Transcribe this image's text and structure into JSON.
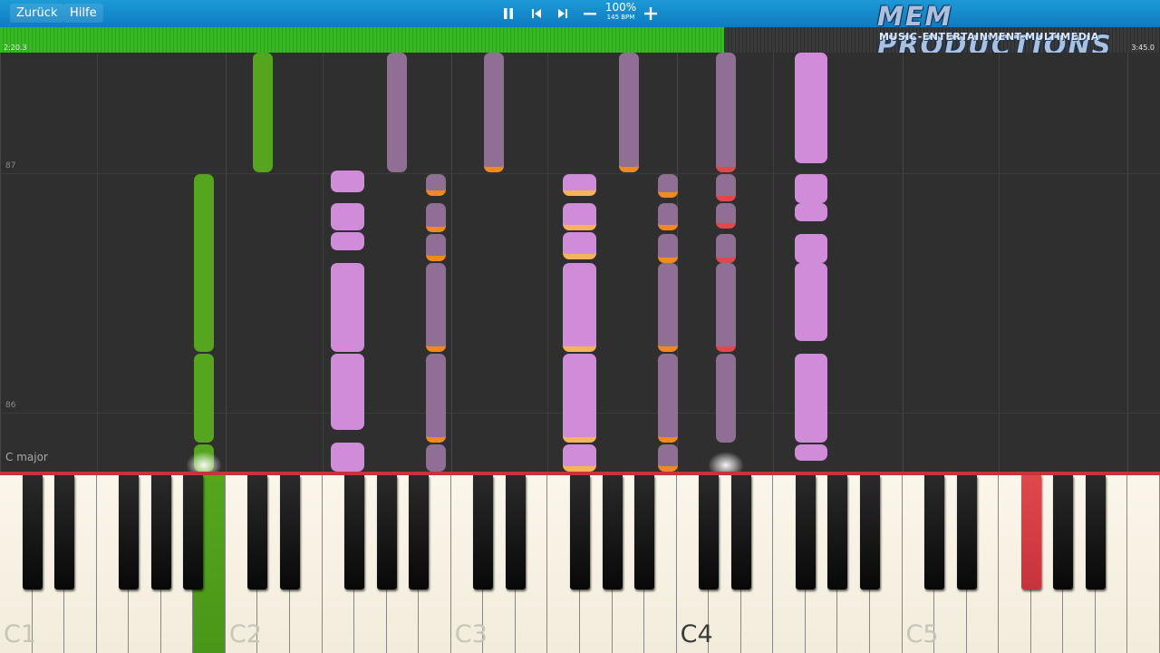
{
  "toolbar": {
    "back_label": "Zurück",
    "help_label": "Hilfe",
    "pause_icon": "pause-icon",
    "prev_icon": "skip-back-icon",
    "next_icon": "skip-forward-icon",
    "minus_icon": "minus-icon",
    "plus_icon": "plus-icon",
    "speed": "100%",
    "bpm": "145 BPM"
  },
  "logo": {
    "line1": "MEM PRODUCTIONS",
    "line2": "MUSIC-ENTERTAINMENT-MULTIMEDIA"
  },
  "progress": {
    "fraction": 0.624,
    "elapsed": "2:20.3",
    "total": "3:45.0"
  },
  "piano_roll": {
    "measure_labels": [
      "87",
      "86"
    ],
    "key_signature": "C major"
  },
  "keyboard": {
    "octave_labels": [
      "C1",
      "C2",
      "C3",
      "C4",
      "C5"
    ],
    "colors": {
      "green": "#55a61e",
      "red": "#e0484e",
      "pink": "#d08cd8",
      "mauve": "#8f6f93",
      "orange": "#f0891e",
      "gold": "#f5b45a"
    }
  }
}
